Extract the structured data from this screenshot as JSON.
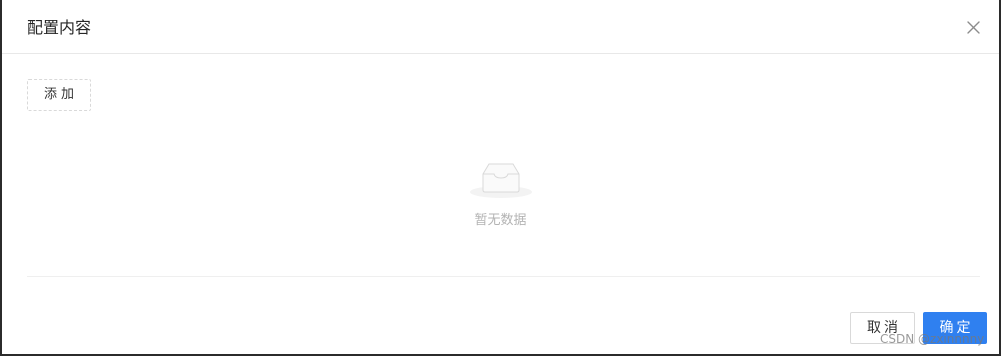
{
  "modal": {
    "title": "配置内容",
    "close_icon": "close-icon",
    "add_label": "添加",
    "empty": {
      "icon": "empty-inbox-icon",
      "text": "暂无数据"
    },
    "footer": {
      "cancel_label": "取消",
      "ok_label": "确定"
    },
    "accent_color": "#2f80f0"
  },
  "watermark": "CSDN @zxinnnny"
}
